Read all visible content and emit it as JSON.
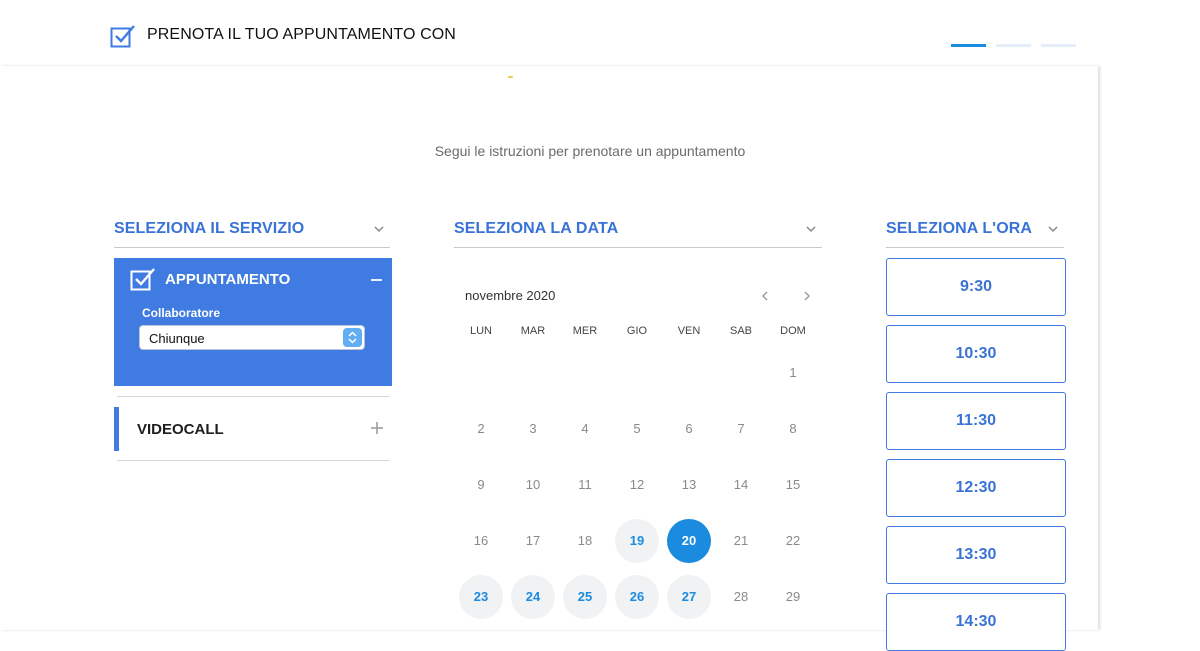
{
  "header": {
    "title": "PRENOTA IL TUO APPUNTAMENTO CON",
    "steps": [
      {
        "active": true
      },
      {
        "active": false
      },
      {
        "active": false
      }
    ]
  },
  "intro": "Segui le istruzioni per prenotare un appuntamento",
  "columns": {
    "service": "SELEZIONA IL SERVIZIO",
    "date": "SELEZIONA LA DATA",
    "time": "SELEZIONA L'ORA"
  },
  "services": {
    "active": {
      "name": "APPUNTAMENTO",
      "collaborator_label": "Collaboratore",
      "collaborator_value": "Chiunque"
    },
    "other": {
      "name": "VIDEOCALL"
    }
  },
  "calendar": {
    "month": "novembre 2020",
    "weekdays": [
      "LUN",
      "MAR",
      "MER",
      "GIO",
      "VEN",
      "SAB",
      "DOM"
    ],
    "weeks": [
      [
        null,
        null,
        null,
        null,
        null,
        null,
        1
      ],
      [
        2,
        3,
        4,
        5,
        6,
        7,
        8
      ],
      [
        9,
        10,
        11,
        12,
        13,
        14,
        15
      ],
      [
        16,
        17,
        18,
        19,
        20,
        21,
        22
      ],
      [
        23,
        24,
        25,
        26,
        27,
        28,
        29
      ]
    ],
    "available_days": [
      19,
      23,
      24,
      25,
      26,
      27
    ],
    "selected_day": 20
  },
  "times": [
    "9:30",
    "10:30",
    "11:30",
    "12:30",
    "13:30",
    "14:30"
  ],
  "colors": {
    "accent": "#3f7be0",
    "selected": "#1b8be0"
  }
}
